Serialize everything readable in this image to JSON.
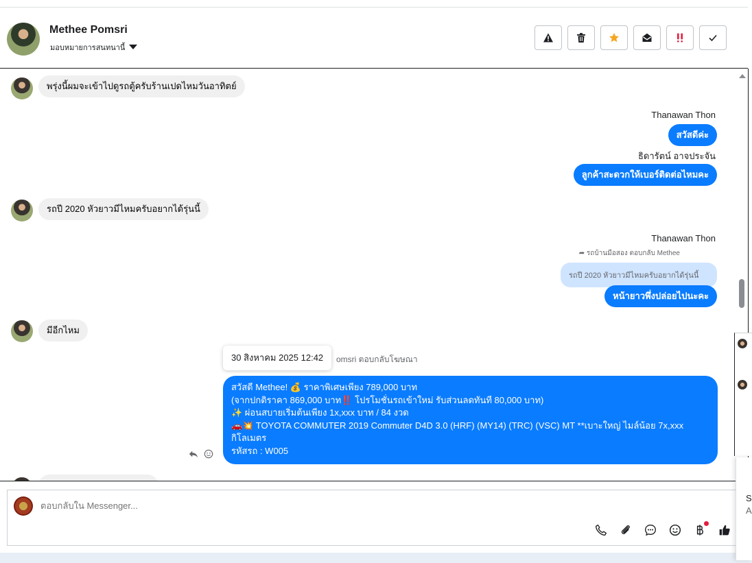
{
  "header": {
    "name": "Methee Pomsri",
    "subtitle": "มอบหมายการสนทนานี้",
    "actions": [
      {
        "icon": "warning-icon",
        "color": "#1c1e21"
      },
      {
        "icon": "trash-icon",
        "color": "#1c1e21"
      },
      {
        "icon": "star-icon",
        "color": "#f5a623"
      },
      {
        "icon": "envelope-open-icon",
        "color": "#1c1e21"
      },
      {
        "icon": "double-exclamation-icon",
        "color": "#e41e3f"
      },
      {
        "icon": "check-icon",
        "color": "#1c1e21"
      }
    ]
  },
  "messages": {
    "m1": "พรุ่งนี้ผมจะเข้าไปดูรถตู้ครับร้านเปดไหมวันอาทิตย์",
    "sender1": "Thanawan Thon",
    "m2": "สวัสดีค่ะ",
    "sender2": "ธิดารัตน์ อาจประจัน",
    "m3": "ลูกค้าสะดวกให้เบอร์ติดต่อไหมคะ",
    "m4": "รถปี 2020  หัวยาวมีไหมครับอยากได้รุ่นนี้",
    "sender3": "Thanawan Thon",
    "reply_note": "รถบ้านมือสอง ตอบกลับ Methee",
    "quoted": "รถปี 2020 หัวยาวมีไหมครับอยากได้รุ่นนี้",
    "m5": "หน้ายาวพึ่งปล่อยไปนะคะ",
    "m6": "มีอีกไหม",
    "tooltip": "30 สิงหาคม 2025 12:42",
    "ad_reply": "omsri ตอบกลับโฆษณา",
    "ad_lines": [
      "สวัสดี Methee! 💰 ราคาพิเศษเพียง 789,000 บาท",
      "(จากปกติราคา 869,000 บาท‼️ โปรโมชั่นรถเข้าใหม่ รับส่วนลดทันที 80,000 บาท)",
      "✨ ผ่อนสบายเริ่มต้นเพียง 1x,xxx บาท / 84 งวด",
      "🚗💥 TOYOTA COMMUTER 2019 Commuter D4D 3.0 (HRF) (MY14) (TRC) (VSC) MT **เบาะใหญ่ ไมล์น้อย 7x,xxx กิโลเมตร",
      " รหัสรถ : W005"
    ]
  },
  "composer": {
    "placeholder": "ตอบกลับใน Messenger...",
    "tools": [
      "phone-icon",
      "paperclip-icon",
      "chat-bubble-icon",
      "emoji-icon",
      "baht-icon",
      "thumbs-up-icon"
    ]
  },
  "edge": {
    "text1": "So",
    "text2": "A"
  }
}
